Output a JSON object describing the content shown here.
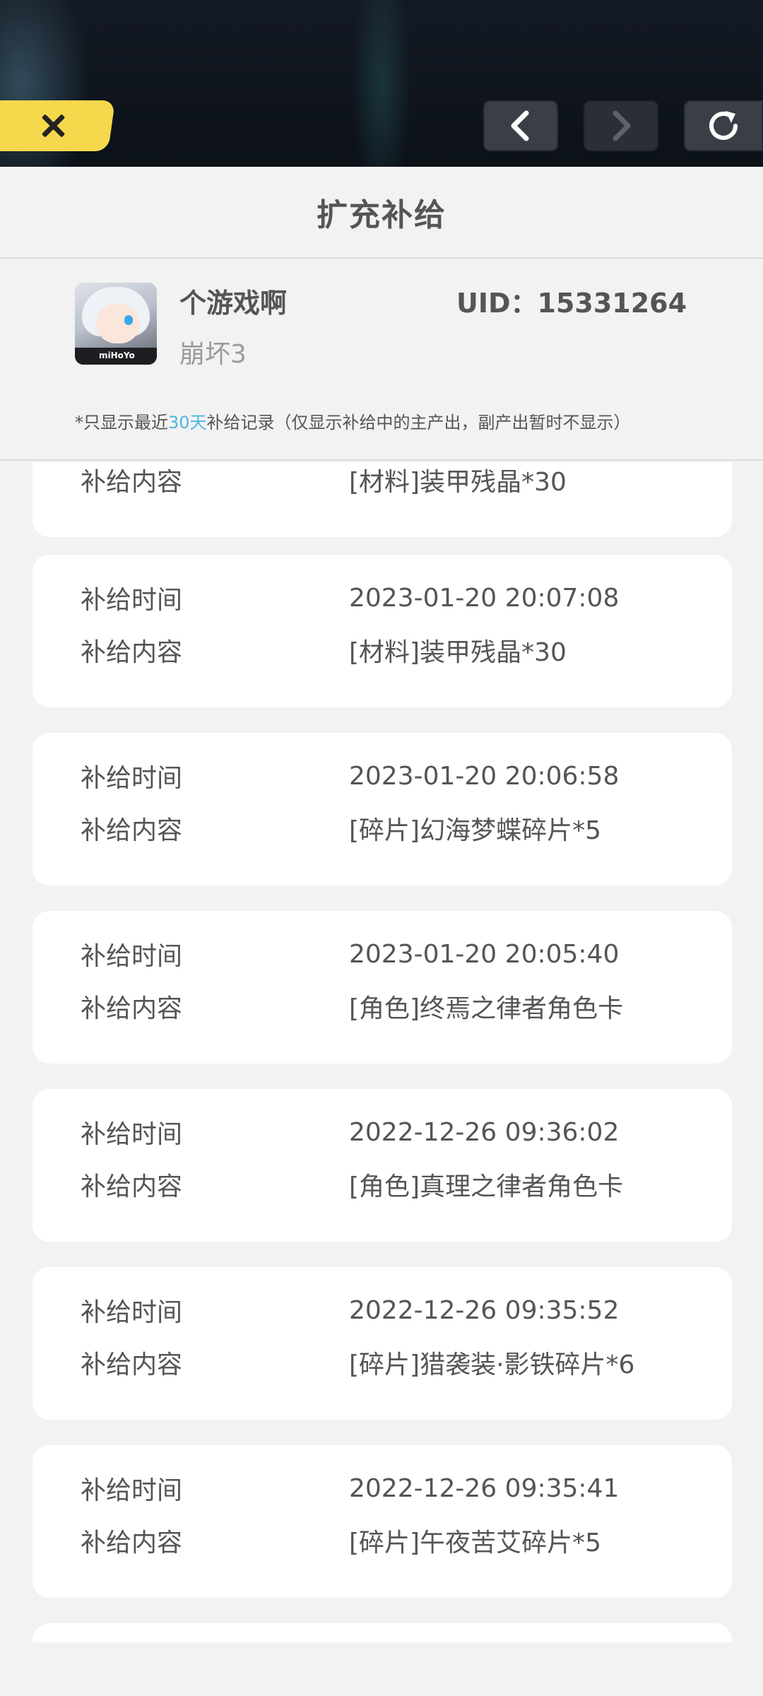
{
  "topbar": {
    "close_icon": "close-icon",
    "back_icon": "chevron-left-icon",
    "forward_icon": "chevron-right-icon",
    "refresh_icon": "refresh-icon"
  },
  "header": {
    "title": "扩充补给"
  },
  "profile": {
    "nickname": "个游戏啊",
    "game": "崩坏3",
    "uid": "UID：15331264",
    "note_prefix": "*只显示最近",
    "note_highlight": "30天",
    "note_suffix": "补给记录（仅显示补给中的主产出，副产出暂时不显示）",
    "highlight_color": "#4fb7df"
  },
  "labels": {
    "time": "补给时间",
    "content": "补给内容"
  },
  "records": [
    {
      "time": "",
      "content": "[材料]装甲残晶*30"
    },
    {
      "time": "2023-01-20 20:07:08",
      "content": "[材料]装甲残晶*30"
    },
    {
      "time": "2023-01-20 20:06:58",
      "content": "[碎片]幻海梦蝶碎片*5"
    },
    {
      "time": "2023-01-20 20:05:40",
      "content": "[角色]终焉之律者角色卡"
    },
    {
      "time": "2022-12-26 09:36:02",
      "content": "[角色]真理之律者角色卡"
    },
    {
      "time": "2022-12-26 09:35:52",
      "content": "[碎片]猎袭装·影铁碎片*6"
    },
    {
      "time": "2022-12-26 09:35:41",
      "content": "[碎片]午夜苦艾碎片*5"
    }
  ]
}
